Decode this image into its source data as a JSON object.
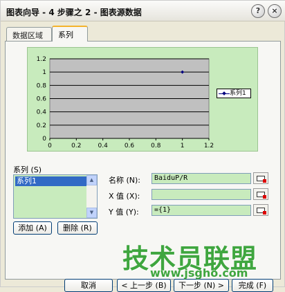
{
  "window": {
    "title": "图表向导 - 4 步骤之 2 - 图表源数据"
  },
  "titlebar_buttons": {
    "help": "?",
    "close": "×"
  },
  "tabs": [
    {
      "label": "数据区域",
      "active": false
    },
    {
      "label": "系列",
      "active": true
    }
  ],
  "chart_data": {
    "type": "scatter",
    "series": [
      {
        "name": "系列1",
        "points": [
          {
            "x": 1,
            "y": 1
          }
        ]
      }
    ],
    "xlim": [
      0,
      1.2
    ],
    "ylim": [
      0,
      1.2
    ],
    "x_ticks": [
      "0",
      "0.2",
      "0.4",
      "0.6",
      "0.8",
      "1",
      "1.2"
    ],
    "y_ticks": [
      "0",
      "0.2",
      "0.4",
      "0.6",
      "0.8",
      "1",
      "1.2"
    ],
    "grid": true,
    "legend_position": "right",
    "colors": {
      "plot_bg": "#c0c0c0",
      "series": "#00007f",
      "chart_bg": "#c8ebbd"
    }
  },
  "series_panel": {
    "label": "系列 (S)",
    "items": [
      "系列1"
    ],
    "add_button": "添加 (A)",
    "delete_button": "删除 (R)"
  },
  "fields": {
    "name_label": "名称 (N):",
    "name_value": "BaiduP/R",
    "x_label": "X 值 (X):",
    "x_value": "",
    "y_label": "Y 值 (Y):",
    "y_value": "={1}"
  },
  "footer": {
    "cancel": "取消",
    "back": "< 上一步 (B)",
    "next": "下一步 (N) >",
    "finish": "完成 (F)"
  },
  "watermark": {
    "text": "技术员联盟",
    "url": "www.jsgho.com"
  },
  "icons": {
    "help": "help-icon",
    "close": "close-icon",
    "range_picker": "range-picker-icon"
  }
}
